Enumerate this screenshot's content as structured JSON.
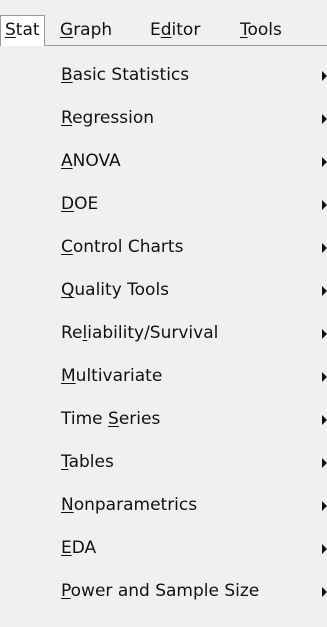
{
  "menubar": {
    "items": [
      {
        "label": "Stat",
        "mnemonic_index": 0,
        "open": true
      },
      {
        "label": "Graph",
        "mnemonic_index": 0,
        "open": false
      },
      {
        "label": "Editor",
        "mnemonic_index": 1,
        "open": false
      },
      {
        "label": "Tools",
        "mnemonic_index": 0,
        "open": false
      }
    ]
  },
  "stat_menu": {
    "items": [
      {
        "label": "Basic Statistics",
        "mnemonic_index": 0,
        "has_submenu": true,
        "icon": "submenu-arrow-icon"
      },
      {
        "label": "Regression",
        "mnemonic_index": 0,
        "has_submenu": true,
        "icon": "submenu-arrow-icon"
      },
      {
        "label": "ANOVA",
        "mnemonic_index": 0,
        "has_submenu": true,
        "icon": "submenu-arrow-icon"
      },
      {
        "label": "DOE",
        "mnemonic_index": 0,
        "has_submenu": true,
        "icon": "submenu-arrow-icon"
      },
      {
        "label": "Control Charts",
        "mnemonic_index": 0,
        "has_submenu": true,
        "icon": "submenu-arrow-icon"
      },
      {
        "label": "Quality Tools",
        "mnemonic_index": 0,
        "has_submenu": true,
        "icon": "submenu-arrow-icon"
      },
      {
        "label": "Reliability/Survival",
        "mnemonic_index": 2,
        "has_submenu": true,
        "icon": "submenu-arrow-icon"
      },
      {
        "label": "Multivariate",
        "mnemonic_index": 0,
        "has_submenu": true,
        "icon": "submenu-arrow-icon"
      },
      {
        "label": "Time Series",
        "mnemonic_index": 5,
        "has_submenu": true,
        "icon": "submenu-arrow-icon"
      },
      {
        "label": "Tables",
        "mnemonic_index": 0,
        "has_submenu": true,
        "icon": "submenu-arrow-icon"
      },
      {
        "label": "Nonparametrics",
        "mnemonic_index": 0,
        "has_submenu": true,
        "icon": "submenu-arrow-icon"
      },
      {
        "label": "EDA",
        "mnemonic_index": 0,
        "has_submenu": true,
        "icon": "submenu-arrow-icon"
      },
      {
        "label": "Power and Sample Size",
        "mnemonic_index": 0,
        "has_submenu": true,
        "icon": "submenu-arrow-icon"
      }
    ]
  },
  "colors": {
    "menu_background": "#f0f0f0",
    "open_item_background": "#ffffff",
    "border": "#9a9a9a",
    "text": "#111111"
  }
}
